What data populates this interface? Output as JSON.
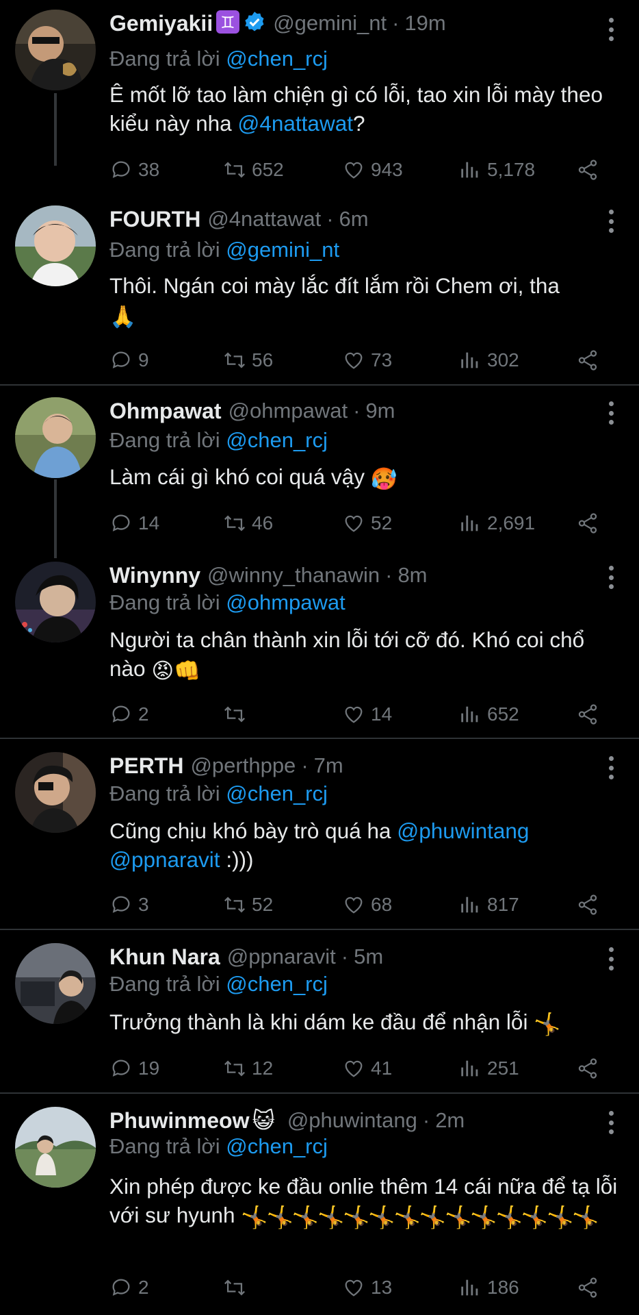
{
  "reply_prefix": "Đang trả lời",
  "tweets": [
    {
      "name": "Gemiyakii",
      "handle": "@gemini_nt",
      "time": "19m",
      "replying_to": "@chen_rcj",
      "text_parts": [
        "Ê mốt lỡ tao làm chiện gì có lỗi, tao xin lỗi mày theo kiểu này nha ",
        "@4nattawat",
        "?"
      ],
      "replies": "38",
      "retweets": "652",
      "likes": "943",
      "views": "5,178"
    },
    {
      "name": "FOURTH",
      "handle": "@4nattawat",
      "time": "6m",
      "replying_to": "@gemini_nt",
      "text_parts": [
        "Thôi. Ngán coi mày lắc đít lắm rồi Chem ơi, tha",
        "",
        "🙏"
      ],
      "replies": "9",
      "retweets": "56",
      "likes": "73",
      "views": "302"
    },
    {
      "name": "Ohmpawat",
      "handle": "@ohmpawat",
      "time": "9m",
      "replying_to": "@chen_rcj",
      "text_parts": [
        "Làm cái gì khó coi quá vậy ",
        "",
        "🥵"
      ],
      "replies": "14",
      "retweets": "46",
      "likes": "52",
      "views": "2,691"
    },
    {
      "name": "Winynny",
      "handle": "@winny_thanawin",
      "time": "8m",
      "replying_to": "@ohmpawat",
      "text_parts": [
        "Người ta chân thành xin lỗi tới cỡ đó. Khó coi chổ nào ",
        "",
        "😡👊"
      ],
      "replies": "2",
      "retweets": "",
      "likes": "14",
      "views": "652"
    },
    {
      "name": "PERTH",
      "handle": "@perthppe",
      "time": "7m",
      "replying_to": "@chen_rcj",
      "text_parts": [
        "Cũng chịu khó bày trò quá ha ",
        "@phuwintang",
        " "
      ],
      "text_parts2": [
        "@ppnaravit",
        " :)))"
      ],
      "replies": "3",
      "retweets": "52",
      "likes": "68",
      "views": "817"
    },
    {
      "name": "Khun Nara",
      "handle": "@ppnaravit",
      "time": "5m",
      "replying_to": "@chen_rcj",
      "text_parts": [
        "Trưởng thành là khi dám ke đầu để nhận lỗi ",
        "",
        "🤸"
      ],
      "replies": "19",
      "retweets": "12",
      "likes": "41",
      "views": "251"
    },
    {
      "name": "Phuwinmeow",
      "handle": "@phuwintang",
      "time": "2m",
      "replying_to": "@chen_rcj",
      "text_parts": [
        "Xin phép được ke đầu onlie thêm 14 cái nữa để tạ lỗi với sư hyunh ",
        "",
        "🤸🤸🤸🤸🤸🤸🤸🤸🤸🤸🤸🤸🤸🤸"
      ],
      "replies": "2",
      "retweets": "",
      "likes": "13",
      "views": "186"
    }
  ],
  "name_badges": {
    "gemini_sign": "♊",
    "verified_color": "#1d9bf0",
    "cat_emoji": "😺"
  },
  "colors": {
    "background": "#000000",
    "text": "#e7e9ea",
    "secondary": "#71767b",
    "link": "#1d9bf0"
  }
}
